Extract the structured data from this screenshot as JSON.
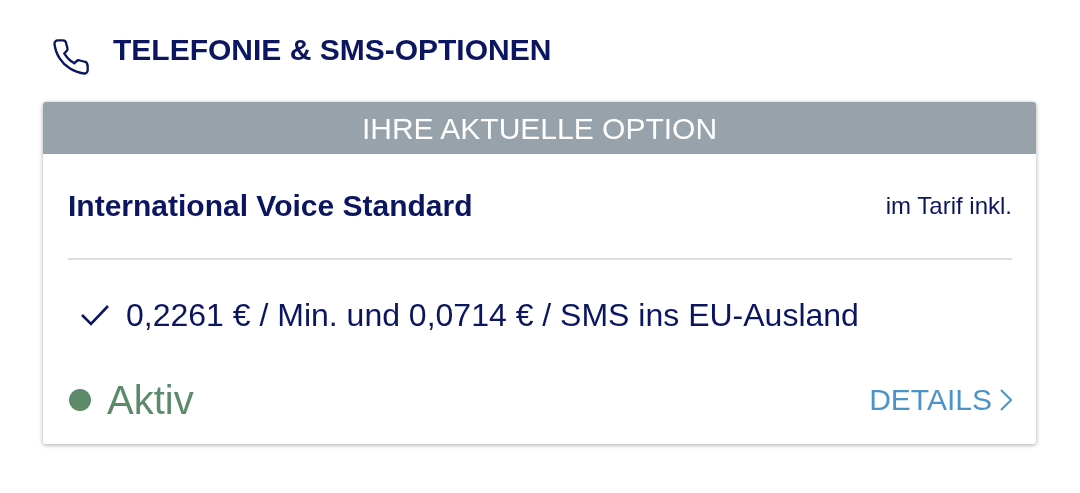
{
  "section": {
    "title": "TELEFONIE & SMS-OPTIONEN"
  },
  "card": {
    "banner": "IHRE AKTUELLE OPTION",
    "option_name": "International Voice Standard",
    "price_note": "im Tarif inkl.",
    "features": [
      "0,2261 € / Min. und 0,0714 € / SMS ins EU-Ausland"
    ],
    "status": {
      "label": "Aktiv",
      "kind": "active"
    },
    "details_link": "DETAILS"
  }
}
